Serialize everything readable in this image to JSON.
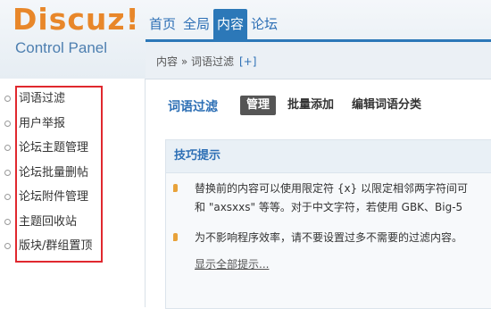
{
  "brand": {
    "logo": "Discuz!",
    "subtitle": "Control Panel"
  },
  "topnav": {
    "items": [
      {
        "label": "首页",
        "active": false
      },
      {
        "label": "全局",
        "active": false
      },
      {
        "label": "内容",
        "active": true
      },
      {
        "label": "论坛",
        "active": false
      }
    ]
  },
  "breadcrumb": {
    "path": "内容 » 词语过滤",
    "add": "[+]"
  },
  "sidebar": {
    "items": [
      "词语过滤",
      "用户举报",
      "论坛主题管理",
      "论坛批量删帖",
      "论坛附件管理",
      "主题回收站",
      "版块/群组置顶"
    ],
    "highlight_color": "#e0282e"
  },
  "main": {
    "title": "词语过滤",
    "tabs": [
      {
        "label": "管理",
        "active": true
      },
      {
        "label": "批量添加",
        "active": false
      },
      {
        "label": "编辑词语分类",
        "active": false
      }
    ]
  },
  "tips": {
    "title": "技巧提示",
    "items": [
      {
        "line1": "替换前的内容可以使用限定符 {x} 以限定相邻两字符间可",
        "line2": "和 \"axsxxs\" 等等。对于中文字符，若使用 GBK、Big-5"
      },
      {
        "line1": "为不影响程序效率，请不要设置过多不需要的过滤内容。"
      }
    ],
    "show_all": "显示全部提示..."
  },
  "colors": {
    "accent": "#2c78b8",
    "logo": "#e8872a",
    "tip_bullet": "#e8a23a"
  }
}
